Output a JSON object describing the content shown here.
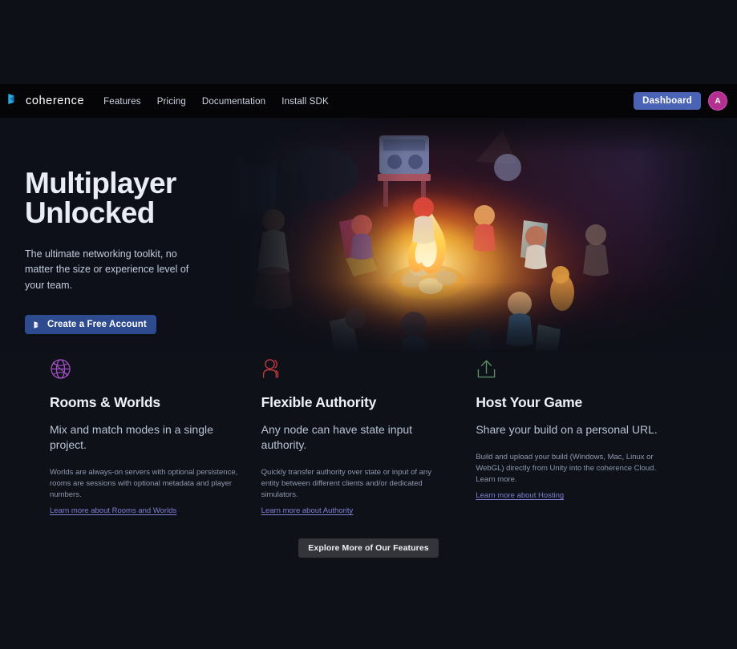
{
  "brand": {
    "name": "coherence",
    "logo_icon": "coherence-logo-icon",
    "accent_color": "#29b6f6"
  },
  "nav": {
    "links": [
      {
        "label": "Features"
      },
      {
        "label": "Pricing"
      },
      {
        "label": "Documentation"
      },
      {
        "label": "Install SDK"
      }
    ],
    "dashboard_label": "Dashboard",
    "dashboard_color": "#4a63b5",
    "avatar_initial": "A",
    "avatar_color": "#b4308f"
  },
  "hero": {
    "title": "Multiplayer\nUnlocked",
    "subtitle": "The ultimate networking toolkit, no matter the size or experience level of your team.",
    "cta_label": "Create a Free Account",
    "cta_icon": "coherence-logo-icon",
    "cta_color": "#2f4b8f",
    "art_alt": "campfire-scene-illustration"
  },
  "features": [
    {
      "icon": "globe-icon",
      "icon_color": "#a24fc4",
      "title": "Rooms & Worlds",
      "lead": "Mix and match modes in a single project.",
      "body": "Worlds are always-on servers with optional persistence, rooms are sessions with optional metadata and player numbers.",
      "link": "Learn more about Rooms and Worlds"
    },
    {
      "icon": "users-icon",
      "icon_color": "#c0393f",
      "title": "Flexible Authority",
      "lead": "Any node can have state input authority.",
      "body": "Quickly transfer authority over state or input of any entity between different clients and/or dedicated simulators.",
      "link": "Learn more about Authority"
    },
    {
      "icon": "upload-icon",
      "icon_color": "#5a8f63",
      "title": "Host Your Game",
      "lead": "Share your build on a personal URL.",
      "body": "Build and upload your build (Windows, Mac, Linux or WebGL) directly from Unity into the coherence Cloud. Learn more.",
      "link": "Learn more about Hosting"
    }
  ],
  "explore": {
    "label": "Explore More of Our Features"
  }
}
